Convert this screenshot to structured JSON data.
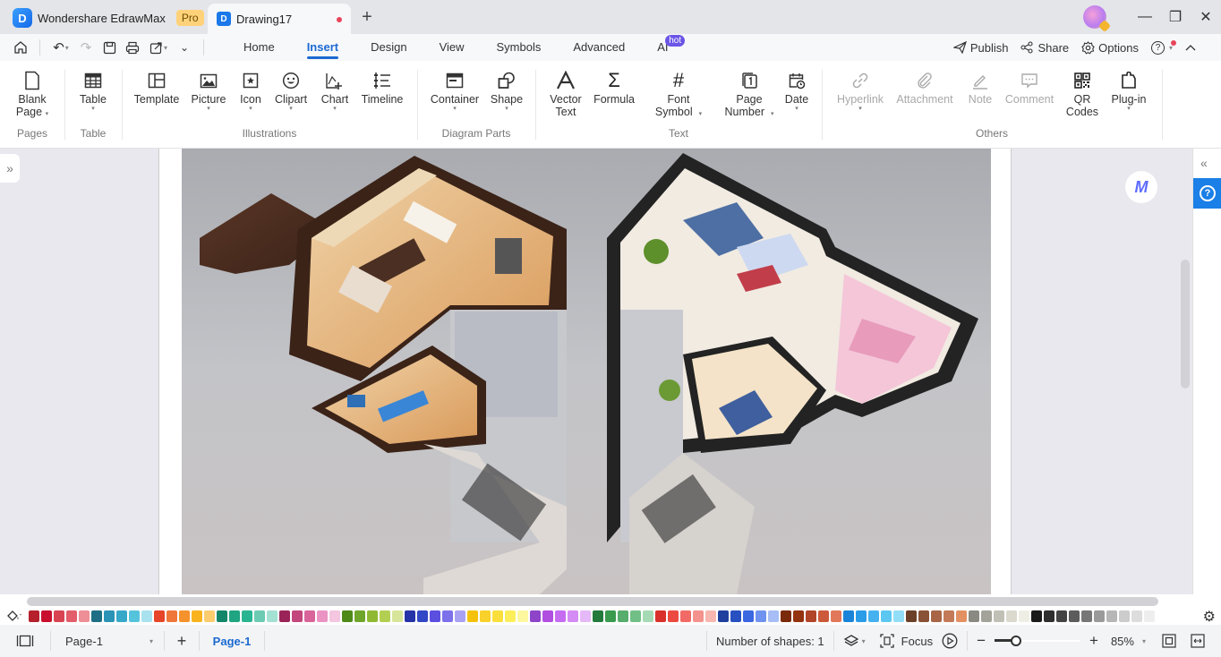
{
  "titlebar": {
    "app_name": "Wondershare EdrawMax",
    "app_badge": "Pro",
    "doc_tab": "Drawing17",
    "new_tab_label": "+",
    "minimize": "—",
    "restore": "❐",
    "close": "✕"
  },
  "quick_access": {
    "home": "⌂",
    "undo": "↶",
    "redo": "↷",
    "save": "🖫",
    "print": "⎙",
    "export": "⇱",
    "more": "⌄"
  },
  "menu": {
    "tabs": [
      {
        "label": "Home"
      },
      {
        "label": "Insert",
        "active": true
      },
      {
        "label": "Design"
      },
      {
        "label": "View"
      },
      {
        "label": "Symbols"
      },
      {
        "label": "Advanced"
      },
      {
        "label": "AI",
        "badge": "hot"
      }
    ],
    "publish": "Publish",
    "share": "Share",
    "options": "Options",
    "help": "?",
    "collapse": "^"
  },
  "ribbon": {
    "groups": {
      "pages": "Pages",
      "table": "Table",
      "illustrations": "Illustrations",
      "diagram_parts": "Diagram Parts",
      "text": "Text",
      "others": "Others"
    },
    "blank_page": [
      "Blank",
      "Page"
    ],
    "table": "Table",
    "template": "Template",
    "picture": "Picture",
    "icon": "Icon",
    "clipart": "Clipart",
    "chart": "Chart",
    "timeline": "Timeline",
    "container": "Container",
    "shape": "Shape",
    "vector_text": [
      "Vector",
      "Text"
    ],
    "formula": "Formula",
    "font_symbol": [
      "Font",
      "Symbol"
    ],
    "page_number": [
      "Page",
      "Number"
    ],
    "date": "Date",
    "hyperlink": "Hyperlink",
    "attachment": "Attachment",
    "note": "Note",
    "comment": "Comment",
    "qr_codes": [
      "QR",
      "Codes"
    ],
    "plug_in": "Plug-in"
  },
  "canvas": {
    "image_description": "3D isometric floor plan of a two-part house with living room, kitchen, bedrooms and staircases",
    "ai_assistant": "M"
  },
  "palette": {
    "colors": [
      "#b5202c",
      "#c8102e",
      "#d94452",
      "#e35d6a",
      "#ee8f98",
      "#1e6f85",
      "#2b93b6",
      "#36a9c9",
      "#56c3dd",
      "#a9e2ef",
      "#e6452a",
      "#f0773a",
      "#f5922b",
      "#f8b31e",
      "#fbcc6e",
      "#13866a",
      "#1fa581",
      "#2ab592",
      "#6dcbb3",
      "#a3e1d2",
      "#9a2457",
      "#c3467d",
      "#d8649a",
      "#eb93c3",
      "#f4c6df",
      "#4e8a18",
      "#6fa52a",
      "#8fb933",
      "#b3cf52",
      "#d7e59a",
      "#2632a8",
      "#3147c6",
      "#5b4fe0",
      "#7c71ea",
      "#a9a2f2",
      "#f4c20d",
      "#f8d12a",
      "#fadf3c",
      "#fbee5a",
      "#fdf7a0",
      "#8d44c8",
      "#b14fe0",
      "#c56cf0",
      "#d48bf4",
      "#e5b8f8",
      "#237a3c",
      "#3a9a4e",
      "#56ad6c",
      "#71bf86",
      "#a6dab4",
      "#d9302b",
      "#ec4a40",
      "#f16a65",
      "#f4928d",
      "#f8b6b0",
      "#1f3f9e",
      "#2850c0",
      "#3b67e0",
      "#6f93ee",
      "#a7bdf6",
      "#7a2a0a",
      "#94330f",
      "#b0452a",
      "#cc5a3a",
      "#e2785a",
      "#1a84d8",
      "#2a9ce8",
      "#45b1ef",
      "#5cc8f2",
      "#93def7",
      "#6b4028",
      "#895236",
      "#a86646",
      "#c37a58",
      "#e39062",
      "#8a8a82",
      "#a3a39a",
      "#c1c0b6",
      "#dbd9ce",
      "#efeee4",
      "#1a1a1a",
      "#2e2e2e",
      "#444444",
      "#5c5c5c",
      "#777777",
      "#9a9a9a",
      "#b6b6b6",
      "#cccccc",
      "#dddddd",
      "#eeeeee"
    ]
  },
  "statusbar": {
    "page_selector": "Page-1",
    "add_page": "+",
    "active_page_tab": "Page-1",
    "shape_count": "Number of shapes: 1",
    "focus": "Focus",
    "zoom_out": "−",
    "zoom_in": "+",
    "zoom_level": "85%",
    "zoom_fraction": 0.25
  }
}
